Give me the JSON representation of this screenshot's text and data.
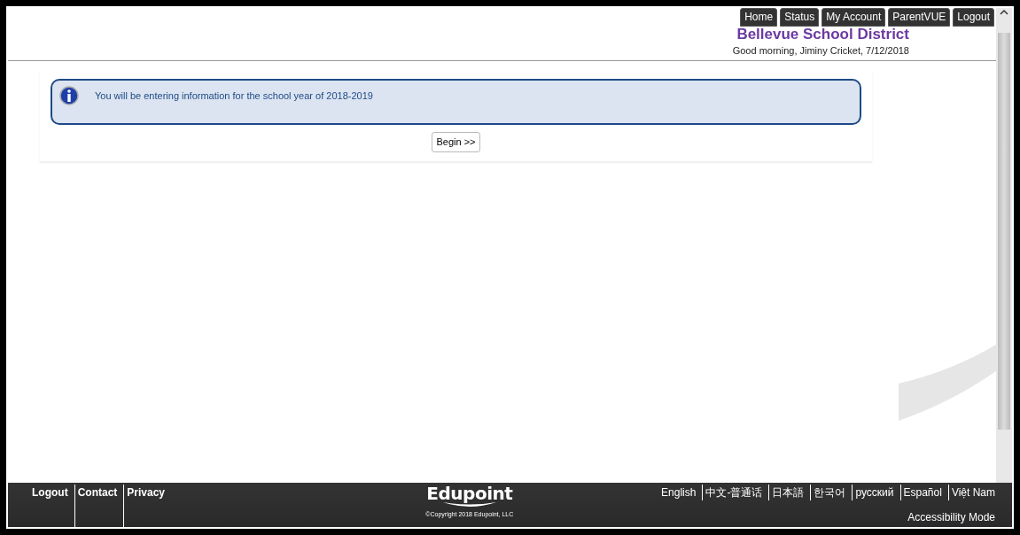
{
  "top_nav": [
    {
      "label": "Home"
    },
    {
      "label": "Status"
    },
    {
      "label": "My Account"
    },
    {
      "label": "ParentVUE"
    },
    {
      "label": "Logout"
    }
  ],
  "district": "Bellevue School District",
  "greeting": "Good morning, Jiminy Cricket, 7/12/2018",
  "info_message": "You will be entering information for the school year of 2018-2019",
  "begin_button": "Begin >>",
  "footer": {
    "links": [
      "Logout",
      "Contact",
      "Privacy"
    ],
    "logo": "Edupoint",
    "copyright": "©Copyright 2018 Edupoint, LLC",
    "languages": [
      "English",
      "中文-普通话",
      "日本語",
      "한국어",
      "русский",
      "Español",
      "Việt Nam"
    ],
    "accessibility": "Accessibility Mode"
  }
}
